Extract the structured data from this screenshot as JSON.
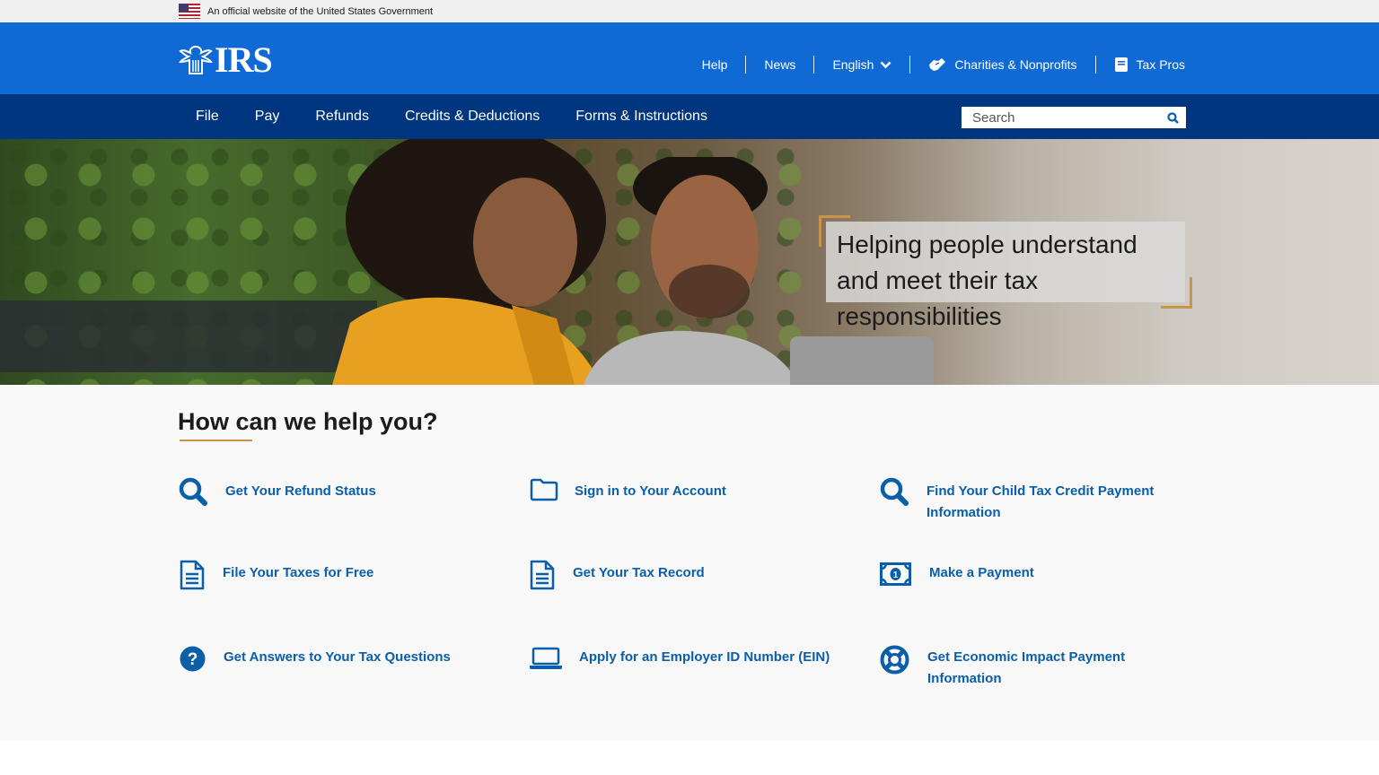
{
  "gov_banner": {
    "text": "An official website of the United States Government"
  },
  "header": {
    "logo_text": "IRS",
    "utility_nav": {
      "help": "Help",
      "news": "News",
      "language": "English",
      "charities": "Charities & Nonprofits",
      "tax_pros": "Tax Pros"
    }
  },
  "main_nav": {
    "items": [
      "File",
      "Pay",
      "Refunds",
      "Credits & Deductions",
      "Forms & Instructions"
    ],
    "search_placeholder": "Search"
  },
  "hero": {
    "tagline": "Helping people understand and meet their tax responsibilities"
  },
  "help": {
    "title": "How can we help you?",
    "links": [
      {
        "label": "Get Your Refund Status",
        "icon": "search-icon"
      },
      {
        "label": "Sign in to Your Account",
        "icon": "folder-icon"
      },
      {
        "label": "Find Your Child Tax Credit Payment Information",
        "icon": "search-icon"
      },
      {
        "label": "File Your Taxes for Free",
        "icon": "document-icon"
      },
      {
        "label": "Get Your Tax Record",
        "icon": "document-icon"
      },
      {
        "label": "Make a Payment",
        "icon": "money-icon"
      },
      {
        "label": "Get Answers to Your Tax Questions",
        "icon": "question-icon"
      },
      {
        "label": "Apply for an Employer ID Number (EIN)",
        "icon": "laptop-icon"
      },
      {
        "label": "Get Economic Impact Payment Information",
        "icon": "lifebuoy-icon"
      }
    ]
  },
  "colors": {
    "header_blue": "#0f6ad6",
    "nav_navy": "#00367f",
    "link_blue": "#0b5ea8",
    "accent_gold": "#c7944a"
  }
}
